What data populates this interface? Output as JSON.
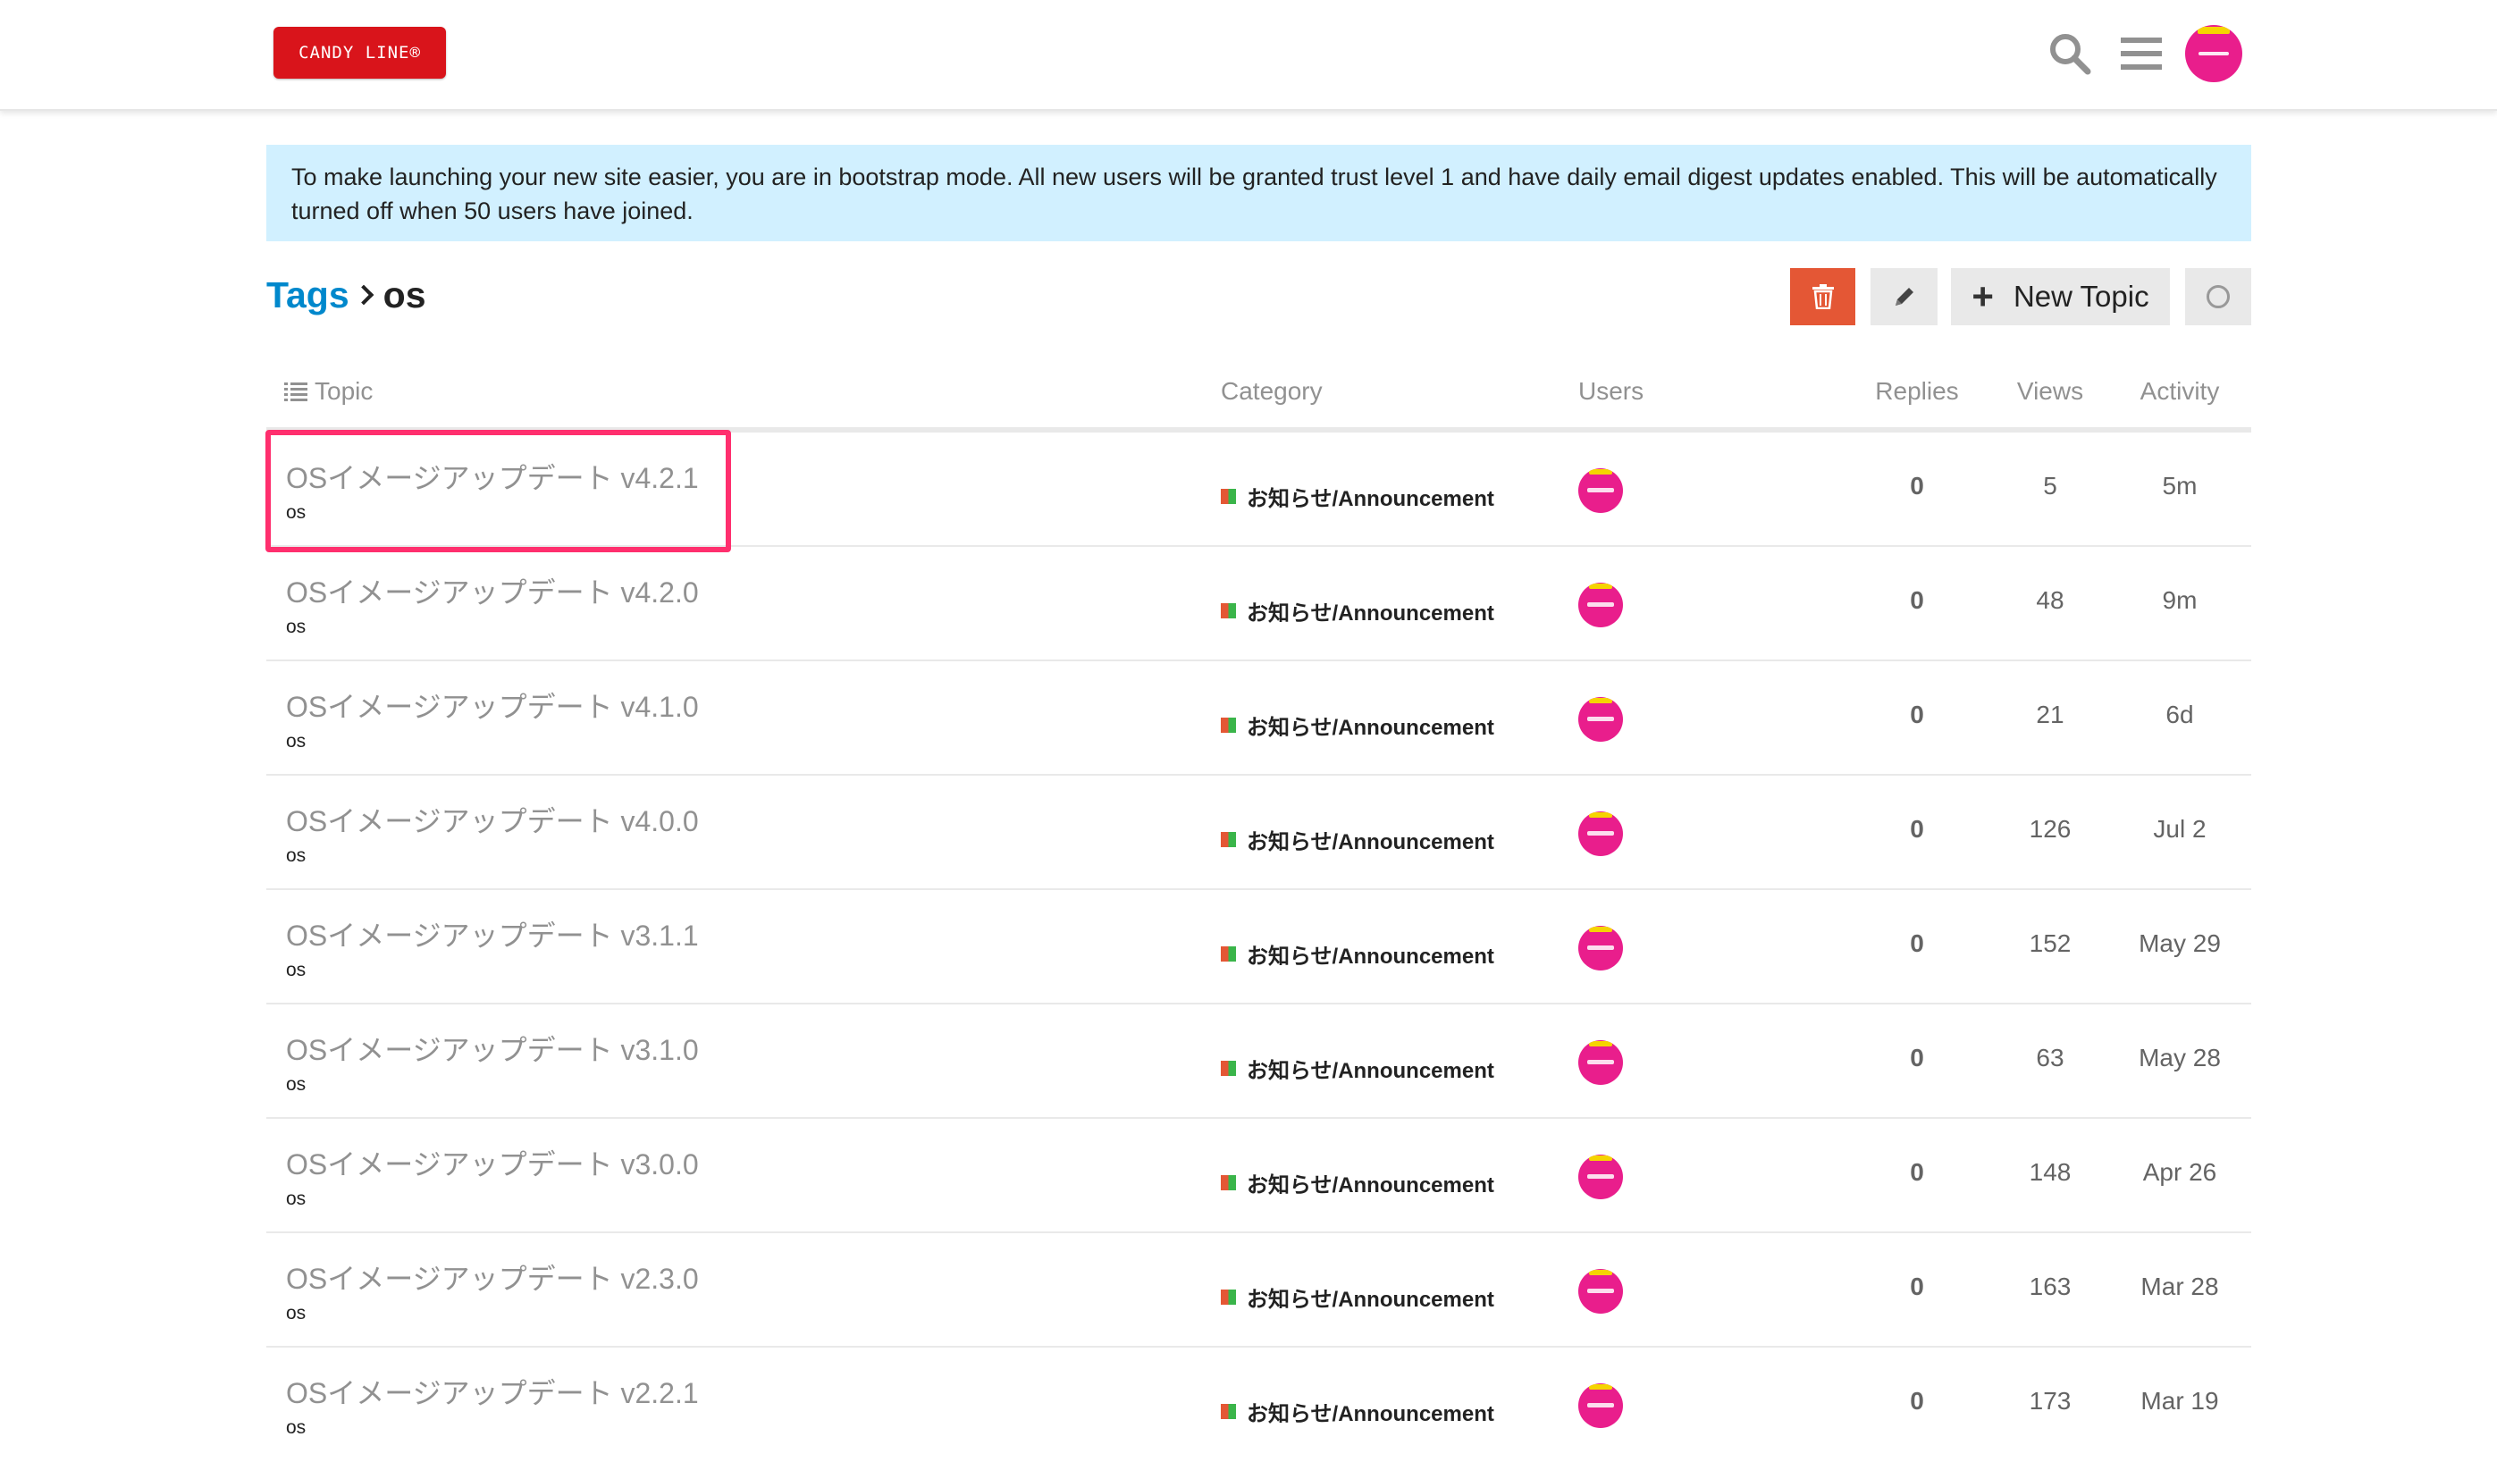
{
  "header": {
    "logo_text": "CANDY LINE®",
    "search_icon": "search-icon",
    "menu_icon": "hamburger-menu-icon",
    "avatar_icon": "user-avatar-icon"
  },
  "banner": {
    "text": "To make launching your new site easier, you are in bootstrap mode. All new users will be granted trust level 1 and have daily email digest updates enabled. This will be automatically turned off when 50 users have joined."
  },
  "breadcrumb": {
    "tags_label": "Tags",
    "current_tag": "os"
  },
  "actions": {
    "delete_icon": "trash-icon",
    "edit_icon": "pencil-icon",
    "new_topic_label": "New Topic",
    "notification_icon": "circle-icon"
  },
  "columns": {
    "topic": "Topic",
    "category": "Category",
    "users": "Users",
    "replies": "Replies",
    "views": "Views",
    "activity": "Activity"
  },
  "topics": [
    {
      "title": "OSイメージアップデート v4.2.1",
      "tag": "os",
      "category": "お知らせ/Announcement",
      "replies": "0",
      "views": "5",
      "activity": "5m"
    },
    {
      "title": "OSイメージアップデート v4.2.0",
      "tag": "os",
      "category": "お知らせ/Announcement",
      "replies": "0",
      "views": "48",
      "activity": "9m"
    },
    {
      "title": "OSイメージアップデート v4.1.0",
      "tag": "os",
      "category": "お知らせ/Announcement",
      "replies": "0",
      "views": "21",
      "activity": "6d"
    },
    {
      "title": "OSイメージアップデート v4.0.0",
      "tag": "os",
      "category": "お知らせ/Announcement",
      "replies": "0",
      "views": "126",
      "activity": "Jul 2"
    },
    {
      "title": "OSイメージアップデート v3.1.1",
      "tag": "os",
      "category": "お知らせ/Announcement",
      "replies": "0",
      "views": "152",
      "activity": "May 29"
    },
    {
      "title": "OSイメージアップデート v3.1.0",
      "tag": "os",
      "category": "お知らせ/Announcement",
      "replies": "0",
      "views": "63",
      "activity": "May 28"
    },
    {
      "title": "OSイメージアップデート v3.0.0",
      "tag": "os",
      "category": "お知らせ/Announcement",
      "replies": "0",
      "views": "148",
      "activity": "Apr 26"
    },
    {
      "title": "OSイメージアップデート v2.3.0",
      "tag": "os",
      "category": "お知らせ/Announcement",
      "replies": "0",
      "views": "163",
      "activity": "Mar 28"
    },
    {
      "title": "OSイメージアップデート v2.2.1",
      "tag": "os",
      "category": "お知らせ/Announcement",
      "replies": "0",
      "views": "173",
      "activity": "Mar 19"
    }
  ],
  "colors": {
    "logo_red": "#d9141b",
    "link_blue": "#0088cc",
    "banner_bg": "#d1f0ff",
    "delete_button": "#e45735",
    "highlight_pink": "#ff2f6e",
    "avatar_pink": "#e91e8c"
  }
}
